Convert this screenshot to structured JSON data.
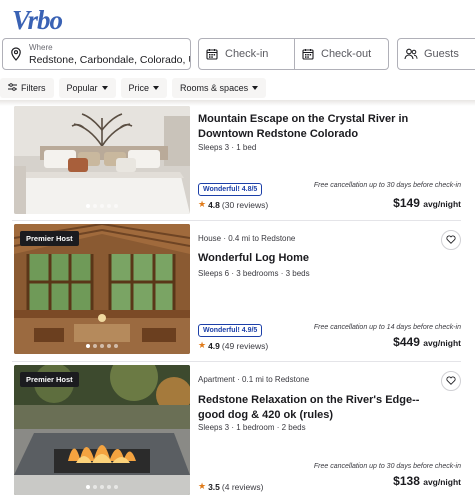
{
  "brand": {
    "logo_text": "Vrbo",
    "color": "#3a62b4"
  },
  "search": {
    "where_label": "Where",
    "where_value": "Redstone, Carbondale, Colorado, U...",
    "checkin_placeholder": "Check-in",
    "checkout_placeholder": "Check-out",
    "guests_placeholder": "Guests"
  },
  "filters": {
    "filters_label": "Filters",
    "popular_label": "Popular",
    "price_label": "Price",
    "rooms_label": "Rooms & spaces"
  },
  "listings": [
    {
      "meta": "",
      "title": "Mountain Escape on the Crystal River in Downtown Redstone Colorado",
      "sleeps": "Sleeps 3 · 1 bed",
      "badge": "",
      "wonderful": "Wonderful! 4.8/5",
      "rating": "4.8",
      "reviews": "(30 reviews)",
      "cancel": "Free cancellation up to 30 days before check-in",
      "price": "$149",
      "price_unit": "avg/night"
    },
    {
      "meta": "House · 0.4 mi to Redstone",
      "title": "Wonderful Log Home",
      "sleeps": "Sleeps 6 · 3 bedrooms · 3 beds",
      "badge": "Premier Host",
      "wonderful": "Wonderful! 4.9/5",
      "rating": "4.9",
      "reviews": "(49 reviews)",
      "cancel": "Free cancellation up to 14 days before check-in",
      "price": "$449",
      "price_unit": "avg/night"
    },
    {
      "meta": "Apartment · 0.1 mi to Redstone",
      "title": "Redstone Relaxation on the River's Edge--good dog & 420 ok (rules)",
      "sleeps": "Sleeps 3 · 1 bedroom · 2 beds",
      "badge": "Premier Host",
      "wonderful": "",
      "rating": "3.5",
      "reviews": "(4 reviews)",
      "cancel": "Free cancellation up to 30 days before check-in",
      "price": "$138",
      "price_unit": "avg/night"
    }
  ]
}
